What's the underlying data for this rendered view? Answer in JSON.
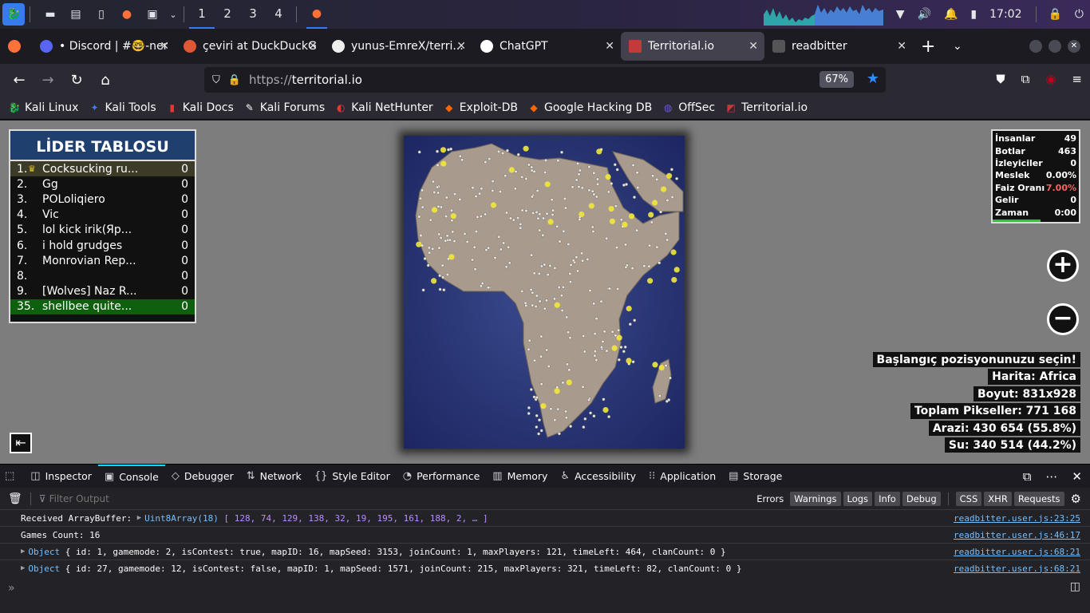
{
  "taskbar": {
    "workspaces": [
      "1",
      "2",
      "3",
      "4"
    ],
    "clock": "17:02"
  },
  "tabs": [
    {
      "title": "• Discord | #🤓-nerd",
      "favicon": "discord-icon",
      "color": "#5865f2"
    },
    {
      "title": "çeviri at DuckDuckGo",
      "favicon": "duckduckgo-icon",
      "color": "#de5833"
    },
    {
      "title": "yunus-EmreX/terri...",
      "favicon": "github-icon",
      "color": "#333"
    },
    {
      "title": "ChatGPT",
      "favicon": "chatgpt-icon",
      "color": "#ffffff"
    },
    {
      "title": "Territorial.io",
      "favicon": "territorial-icon",
      "color": "#c23b3b",
      "active": true
    },
    {
      "title": "readbitter",
      "favicon": "readbitter-icon",
      "color": "#444"
    }
  ],
  "nav": {
    "url_proto": "https://",
    "url_host": "territorial.io",
    "zoom": "67%"
  },
  "bookmarks": [
    "Kali Linux",
    "Kali Tools",
    "Kali Docs",
    "Kali Forums",
    "Kali NetHunter",
    "Exploit-DB",
    "Google Hacking DB",
    "OffSec",
    "Territorial.io"
  ],
  "game": {
    "leaderboard_title": "LİDER TABLOSU",
    "leaderboard": [
      {
        "rank": "1.",
        "name": "Cocksucking ru...",
        "score": "0"
      },
      {
        "rank": "2.",
        "name": "Gg",
        "score": "0"
      },
      {
        "rank": "3.",
        "name": "POLoliqiero",
        "score": "0"
      },
      {
        "rank": "4.",
        "name": "Vic",
        "score": "0"
      },
      {
        "rank": "5.",
        "name": "lol kick irik(Яр...",
        "score": "0"
      },
      {
        "rank": "6.",
        "name": "i hold grudges",
        "score": "0"
      },
      {
        "rank": "7.",
        "name": "Monrovian Rep...",
        "score": "0"
      },
      {
        "rank": "8.",
        "name": "",
        "score": "0"
      },
      {
        "rank": "9.",
        "name": "[Wolves] Naz R...",
        "score": "0"
      },
      {
        "rank": "35.",
        "name": "shellbee quite...",
        "score": "0"
      }
    ],
    "stats": [
      {
        "label": "İnsanlar",
        "value": "49"
      },
      {
        "label": "Botlar",
        "value": "463"
      },
      {
        "label": "İzleyiciler",
        "value": "0"
      },
      {
        "label": "Meslek",
        "value": "0.00%"
      },
      {
        "label": "Faiz Oranı",
        "value": "7.00%"
      },
      {
        "label": "Gelir",
        "value": "0"
      },
      {
        "label": "Zaman",
        "value": "0:00"
      }
    ],
    "info": [
      "Başlangıç pozisyonunuzu seçin!",
      "Harita: Africa",
      "Boyut: 831x928",
      "Toplam Pikseller: 771 168",
      "Arazi: 430 654 (55.8%)",
      "Su: 340 514 (44.2%)"
    ]
  },
  "devtools": {
    "tabs": [
      "Inspector",
      "Console",
      "Debugger",
      "Network",
      "Style Editor",
      "Performance",
      "Memory",
      "Accessibility",
      "Application",
      "Storage"
    ],
    "filter_placeholder": "Filter Output",
    "filter_buttons": [
      "Errors",
      "Warnings",
      "Logs",
      "Info",
      "Debug",
      "CSS",
      "XHR",
      "Requests"
    ],
    "logs": [
      {
        "text": "Received ArrayBuffer: ",
        "cls": "Uint8Array(18)",
        "rest": " [ 128, 74, 129, 138, 32, 19, 195, 161, 188, 2, … ]",
        "src": "readbitter.user.js:23:25"
      },
      {
        "text": "Games Count: 16",
        "cls": "",
        "rest": "",
        "src": "readbitter.user.js:46:17"
      },
      {
        "text": "",
        "cls": "Object",
        "rest": " { id: 1, gamemode: 2, isContest: true, mapID: 16, mapSeed: 3153, joinCount: 1, maxPlayers: 121, timeLeft: 464, clanCount: 0 }",
        "src": "readbitter.user.js:68:21"
      },
      {
        "text": "",
        "cls": "Object",
        "rest": " { id: 27, gamemode: 12, isContest: false, mapID: 1, mapSeed: 1571, joinCount: 215, maxPlayers: 321, timeLeft: 82, clanCount: 0 }",
        "src": "readbitter.user.js:68:21"
      }
    ],
    "prompt": "»"
  }
}
